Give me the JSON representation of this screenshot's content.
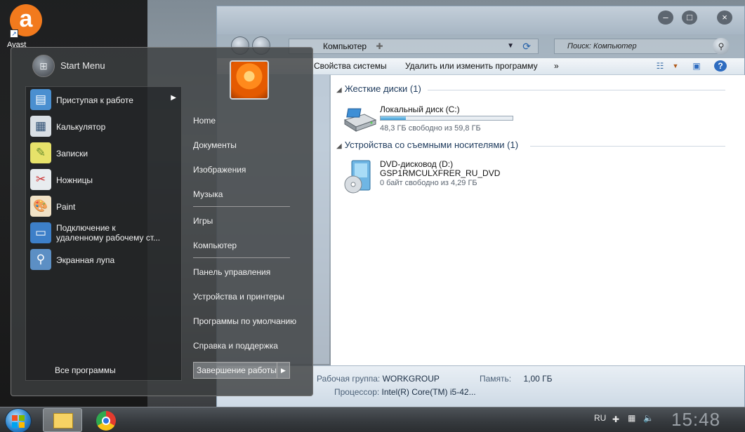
{
  "desktop": {
    "avast_label": "Avast"
  },
  "explorer": {
    "address": "Компьютер",
    "search_placeholder": "Поиск: Компьютер",
    "toolbar": {
      "system_properties": "Свойства системы",
      "uninstall": "Удалить или изменить программу",
      "more": "»"
    },
    "groups": [
      {
        "title": "Жесткие диски (1)",
        "items": [
          {
            "name": "Локальный диск (C:)",
            "free": "48,3 ГБ свободно из 59,8 ГБ",
            "used_fraction": 0.19
          }
        ]
      },
      {
        "title": "Устройства со съемными носителями (1)",
        "items": [
          {
            "name": "DVD-дисковод (D:)",
            "label": "GSP1RMCULXFRER_RU_DVD",
            "free": "0 байт свободно из 4,29 ГБ"
          }
        ]
      }
    ],
    "details": {
      "workgroup_key": "Рабочая группа:",
      "workgroup_val": "WORKGROUP",
      "memory_key": "Память:",
      "memory_val": "1,00 ГБ",
      "cpu_key": "Процессор:",
      "cpu_val": "Intel(R) Core(TM) i5-42..."
    }
  },
  "start_menu": {
    "title": "Start Menu",
    "programs": [
      {
        "label": "Приступая к работе",
        "icon": "getting-started-icon",
        "submenu": true
      },
      {
        "label": "Калькулятор",
        "icon": "calculator-icon"
      },
      {
        "label": "Записки",
        "icon": "sticky-notes-icon"
      },
      {
        "label": "Ножницы",
        "icon": "snipping-tool-icon"
      },
      {
        "label": "Paint",
        "icon": "paint-icon"
      },
      {
        "label1": "Подключение к",
        "label2": "удаленному рабочему ст...",
        "icon": "remote-desktop-icon"
      },
      {
        "label": "Экранная лупа",
        "icon": "magnifier-icon"
      }
    ],
    "all_programs": "Все программы",
    "right": [
      "Home",
      "Документы",
      "Изображения",
      "Музыка",
      "Игры",
      "Компьютер",
      "Панель управления",
      "Устройства и принтеры",
      "Программы по умолчанию",
      "Справка и поддержка"
    ],
    "shutdown": "Завершение работы"
  },
  "taskbar": {
    "language": "RU",
    "clock": "15:48"
  },
  "colors": {
    "accent": "#3a9bd6",
    "avast": "#f27a1d"
  }
}
